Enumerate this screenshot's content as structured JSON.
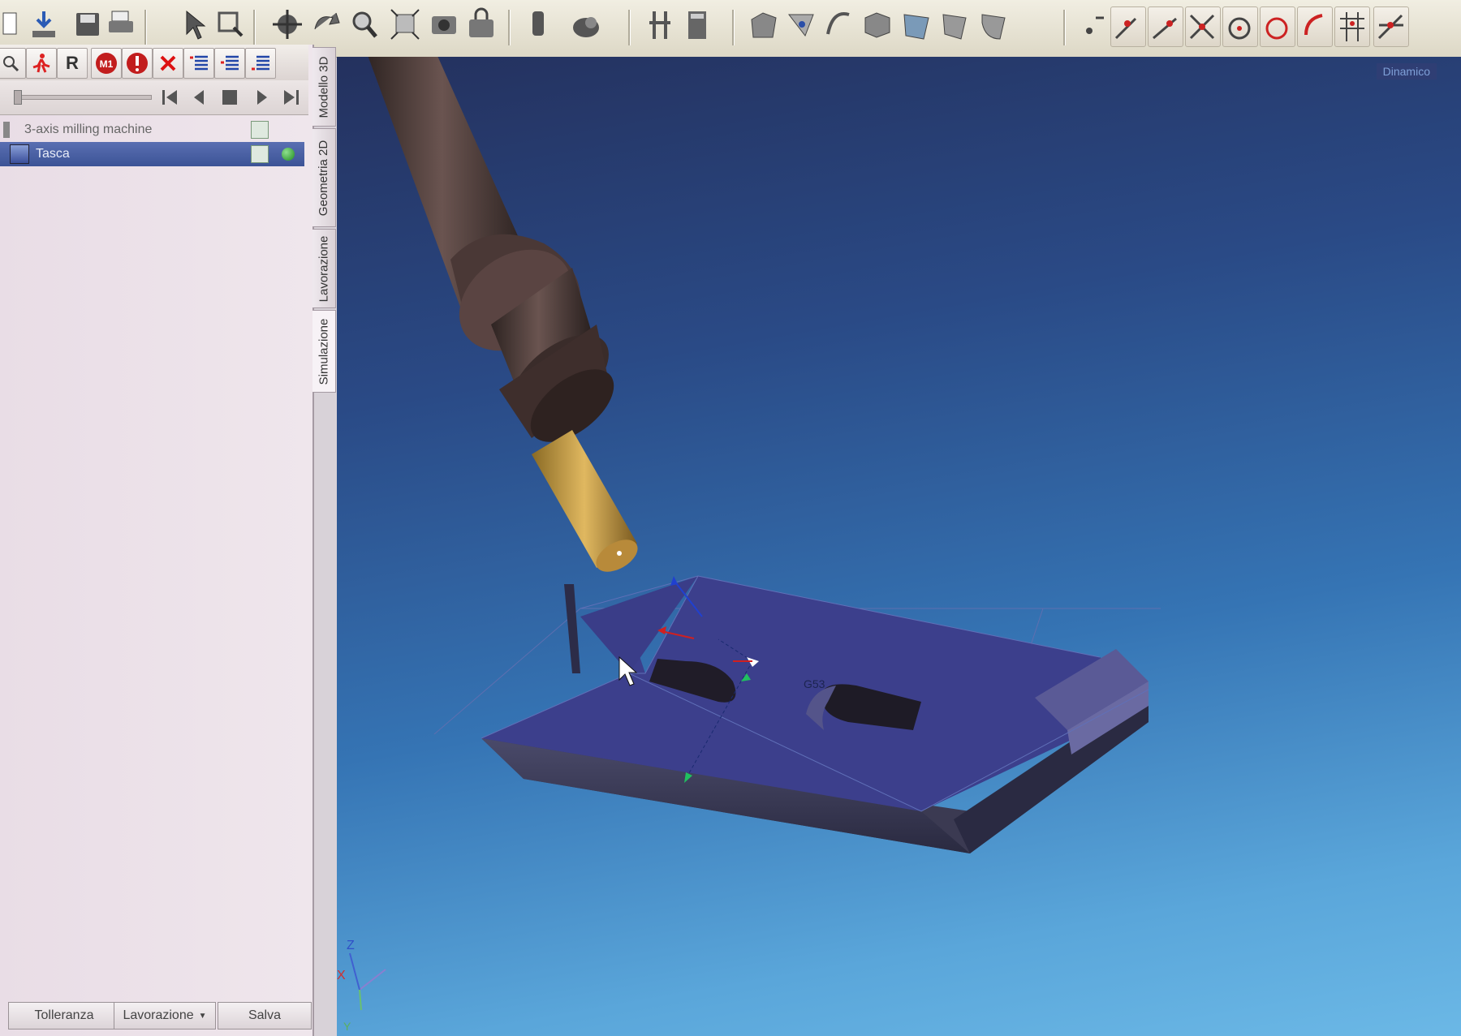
{
  "toolbar": {
    "icons": [
      "new-icon",
      "import-icon",
      "save-icon",
      "print-icon",
      "select-icon",
      "zoom-window-icon",
      "pan-icon",
      "rotate-icon",
      "zoom-icon",
      "fit-icon",
      "camera-icon",
      "camera-lock-icon",
      "tool-icon",
      "shape-icon",
      "column-icon",
      "calculator-icon",
      "surface-icon",
      "point-icon",
      "curve-icon",
      "solid-icon",
      "face-icon",
      "chamfer-icon",
      "fillet-icon",
      "toggle-icon",
      "snap-1-icon",
      "snap-2-icon",
      "snap-3-icon",
      "snap-4-icon",
      "snap-5-icon",
      "snap-6-icon",
      "snap-7-icon",
      "snap-8-icon"
    ]
  },
  "command_bar": {
    "r_label": "R",
    "m1_label": "M1"
  },
  "tree": {
    "items": [
      {
        "label": "3-axis milling machine"
      },
      {
        "label": "Tasca"
      }
    ]
  },
  "tabs": [
    {
      "label": "Modello 3D"
    },
    {
      "label": "Geometria 2D"
    },
    {
      "label": "Lavorazione"
    },
    {
      "label": "Simulazione"
    }
  ],
  "bottom_buttons": {
    "tolerance": "Tolleranza",
    "machining": "Lavorazione",
    "save": "Salva"
  },
  "viewport": {
    "view_label": "Dinamico",
    "origin_label": "G53",
    "axis_z": "Z",
    "axis_x": "X",
    "axis_y": "Y"
  },
  "colors": {
    "part": "#3a3d86",
    "tool_holder": "#4a3a38",
    "tool": "#c89a3c",
    "selection": "#4a5fa4"
  }
}
